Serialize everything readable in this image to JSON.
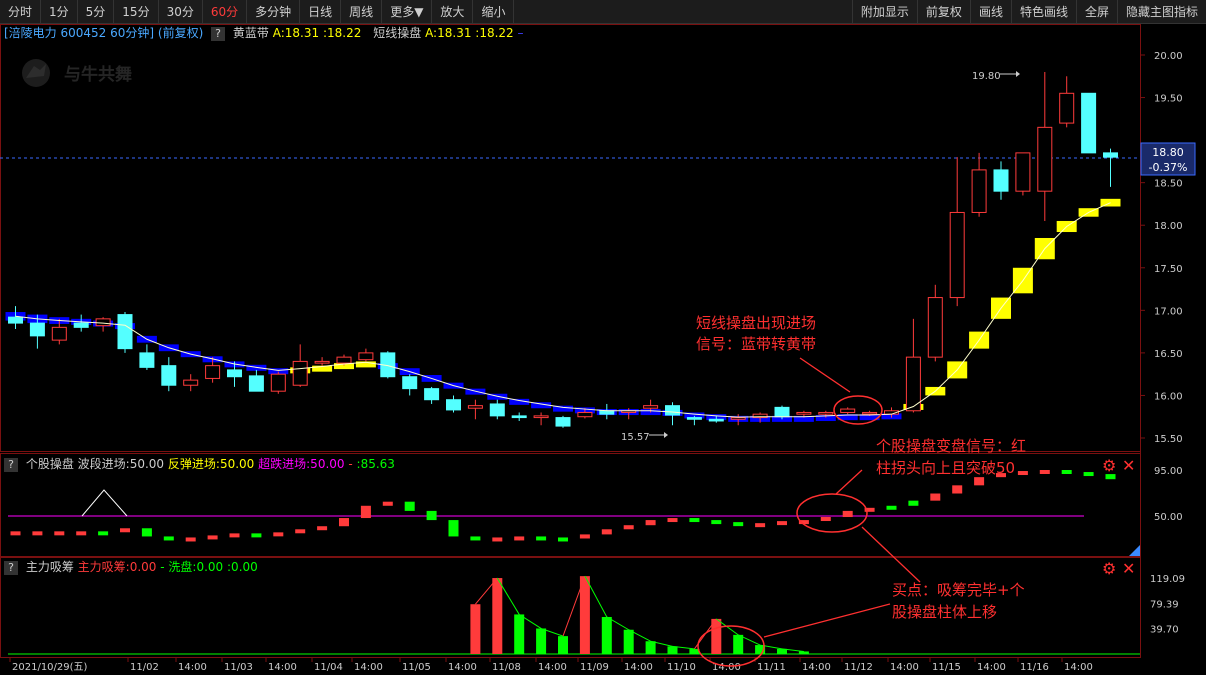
{
  "toolbar": {
    "left": [
      "分时",
      "1分",
      "5分",
      "15分",
      "30分",
      "60分",
      "多分钟",
      "日线",
      "周线",
      "更多▼",
      "放大",
      "缩小"
    ],
    "active": "60分",
    "right": [
      "附加显示",
      "前复权",
      "画线",
      "特色画线",
      "全屏",
      "隐藏主图指标"
    ]
  },
  "main_info": {
    "stock": "[涪陵电力 600452 60分钟] (前复权)",
    "q": "?",
    "ind1_name": "黄蓝带",
    "ind1_vals": "A:18.31",
    "ind1_vals2": ":18.22",
    "ind2_name": "短线操盘",
    "ind2_vals": "A:18.31",
    "ind2_vals2": ":18.22"
  },
  "watermark": "与牛共舞",
  "price_tag": {
    "price": "18.80",
    "change": "-0.37%"
  },
  "high_label": "19.80",
  "low_label": "15.57",
  "sub1_info": {
    "name": "个股操盘",
    "l1": "波段进场:50.00",
    "l2": "反弹进场:50.00",
    "l3": "超跌进场:50.00",
    "l4": "- ",
    "l5": ":85.63"
  },
  "sub2_info": {
    "name": "主力吸筹",
    "l1": "主力吸筹:0.00",
    "l2": "- 洗盘:0.00",
    "l3": ":0.00"
  },
  "annotations": {
    "a1_line1": "短线操盘出现进场",
    "a1_line2": "信号：蓝带转黄带",
    "a2_line1": "个股操盘变盘信号：红",
    "a2_line2": "柱拐头向上且突破50",
    "a3_line1": "买点：吸筹完毕+个",
    "a3_line2": "股操盘柱体上移"
  },
  "controls": {
    "gear": "⚙",
    "close": "✕"
  },
  "price_axis": [
    "20.00",
    "19.50",
    "18.80",
    "18.50",
    "18.00",
    "17.50",
    "17.00",
    "16.50",
    "16.00",
    "15.50"
  ],
  "sub1_axis": [
    "95.00",
    "50.00"
  ],
  "sub2_axis": [
    "119.09",
    "79.39",
    "39.70"
  ],
  "date_axis": [
    "2021/10/29(五)",
    "11/02",
    "14:00",
    "11/03",
    "14:00",
    "11/04",
    "14:00",
    "11/05",
    "14:00",
    "11/08",
    "14:00",
    "11/09",
    "14:00",
    "11/10",
    "14:00",
    "11/11",
    "14:00",
    "11/12",
    "14:00",
    "11/15",
    "14:00",
    "11/16",
    "14:00"
  ],
  "colors": {
    "up": "#ff3b3b",
    "down": "#54ffff",
    "yellow": "#ffff00",
    "blue": "#0000ff",
    "magenta": "#ff00ff",
    "green": "#00ff00"
  },
  "chart_data": {
    "type": "candlestick",
    "ylim": [
      15.4,
      20.1
    ],
    "candles": [
      {
        "o": 16.92,
        "h": 17.05,
        "l": 16.78,
        "c": 16.85
      },
      {
        "o": 16.85,
        "h": 16.95,
        "l": 16.55,
        "c": 16.7
      },
      {
        "o": 16.65,
        "h": 16.9,
        "l": 16.6,
        "c": 16.8
      },
      {
        "o": 16.85,
        "h": 16.95,
        "l": 16.75,
        "c": 16.8
      },
      {
        "o": 16.82,
        "h": 16.92,
        "l": 16.75,
        "c": 16.9
      },
      {
        "o": 16.95,
        "h": 16.98,
        "l": 16.5,
        "c": 16.55
      },
      {
        "o": 16.5,
        "h": 16.6,
        "l": 16.3,
        "c": 16.33
      },
      {
        "o": 16.35,
        "h": 16.45,
        "l": 16.05,
        "c": 16.12
      },
      {
        "o": 16.12,
        "h": 16.25,
        "l": 16.05,
        "c": 16.18
      },
      {
        "o": 16.2,
        "h": 16.45,
        "l": 16.15,
        "c": 16.35
      },
      {
        "o": 16.3,
        "h": 16.4,
        "l": 16.1,
        "c": 16.22
      },
      {
        "o": 16.23,
        "h": 16.3,
        "l": 16.05,
        "c": 16.05
      },
      {
        "o": 16.05,
        "h": 16.28,
        "l": 16.02,
        "c": 16.25
      },
      {
        "o": 16.12,
        "h": 16.6,
        "l": 16.1,
        "c": 16.4
      },
      {
        "o": 16.38,
        "h": 16.45,
        "l": 16.35,
        "c": 16.4
      },
      {
        "o": 16.38,
        "h": 16.48,
        "l": 16.35,
        "c": 16.45
      },
      {
        "o": 16.42,
        "h": 16.55,
        "l": 16.4,
        "c": 16.5
      },
      {
        "o": 16.5,
        "h": 16.52,
        "l": 16.2,
        "c": 16.22
      },
      {
        "o": 16.22,
        "h": 16.25,
        "l": 16.0,
        "c": 16.08
      },
      {
        "o": 16.08,
        "h": 16.1,
        "l": 15.9,
        "c": 15.95
      },
      {
        "o": 15.95,
        "h": 16.0,
        "l": 15.8,
        "c": 15.83
      },
      {
        "o": 15.85,
        "h": 15.95,
        "l": 15.72,
        "c": 15.88
      },
      {
        "o": 15.9,
        "h": 15.95,
        "l": 15.72,
        "c": 15.76
      },
      {
        "o": 15.76,
        "h": 15.8,
        "l": 15.7,
        "c": 15.74
      },
      {
        "o": 15.74,
        "h": 15.8,
        "l": 15.65,
        "c": 15.76
      },
      {
        "o": 15.74,
        "h": 15.76,
        "l": 15.62,
        "c": 15.64
      },
      {
        "o": 15.75,
        "h": 15.85,
        "l": 15.73,
        "c": 15.8
      },
      {
        "o": 15.82,
        "h": 15.9,
        "l": 15.72,
        "c": 15.78
      },
      {
        "o": 15.8,
        "h": 15.85,
        "l": 15.72,
        "c": 15.82
      },
      {
        "o": 15.85,
        "h": 15.95,
        "l": 15.8,
        "c": 15.88
      },
      {
        "o": 15.88,
        "h": 15.92,
        "l": 15.65,
        "c": 15.77
      },
      {
        "o": 15.74,
        "h": 15.76,
        "l": 15.65,
        "c": 15.72
      },
      {
        "o": 15.72,
        "h": 15.76,
        "l": 15.68,
        "c": 15.7
      },
      {
        "o": 15.72,
        "h": 15.78,
        "l": 15.65,
        "c": 15.74
      },
      {
        "o": 15.74,
        "h": 15.8,
        "l": 15.68,
        "c": 15.78
      },
      {
        "o": 15.86,
        "h": 15.88,
        "l": 15.72,
        "c": 15.75
      },
      {
        "o": 15.78,
        "h": 15.82,
        "l": 15.74,
        "c": 15.8
      },
      {
        "o": 15.78,
        "h": 15.82,
        "l": 15.74,
        "c": 15.8
      },
      {
        "o": 15.8,
        "h": 15.86,
        "l": 15.78,
        "c": 15.84
      },
      {
        "o": 15.8,
        "h": 15.82,
        "l": 15.76,
        "c": 15.8
      },
      {
        "o": 15.78,
        "h": 15.86,
        "l": 15.74,
        "c": 15.82
      },
      {
        "o": 15.82,
        "h": 16.9,
        "l": 15.8,
        "c": 16.45
      },
      {
        "o": 16.45,
        "h": 17.3,
        "l": 16.4,
        "c": 17.15
      },
      {
        "o": 17.15,
        "h": 18.8,
        "l": 17.05,
        "c": 18.15
      },
      {
        "o": 18.15,
        "h": 18.85,
        "l": 18.1,
        "c": 18.65
      },
      {
        "o": 18.65,
        "h": 18.75,
        "l": 18.3,
        "c": 18.4
      },
      {
        "o": 18.4,
        "h": 18.85,
        "l": 18.35,
        "c": 18.85
      },
      {
        "o": 18.4,
        "h": 19.8,
        "l": 18.05,
        "c": 19.15
      },
      {
        "o": 19.2,
        "h": 19.75,
        "l": 19.15,
        "c": 19.55
      },
      {
        "o": 19.55,
        "h": 19.55,
        "l": 18.85,
        "c": 18.85
      },
      {
        "o": 18.85,
        "h": 18.9,
        "l": 18.45,
        "c": 18.8
      }
    ],
    "band_a": [
      16.98,
      16.95,
      16.92,
      16.9,
      16.88,
      16.85,
      16.7,
      16.6,
      16.52,
      16.46,
      16.4,
      16.36,
      16.32,
      16.33,
      16.35,
      16.38,
      16.4,
      16.38,
      16.32,
      16.24,
      16.15,
      16.08,
      16.02,
      15.96,
      15.92,
      15.88,
      15.86,
      15.84,
      15.84,
      15.84,
      15.83,
      15.8,
      15.78,
      15.76,
      15.76,
      15.76,
      15.76,
      15.77,
      15.78,
      15.78,
      15.79,
      15.9,
      16.1,
      16.4,
      16.75,
      17.15,
      17.5,
      17.85,
      18.05,
      18.2,
      18.31
    ],
    "band_b": [
      16.88,
      16.85,
      16.84,
      16.83,
      16.82,
      16.8,
      16.62,
      16.52,
      16.45,
      16.4,
      16.34,
      16.3,
      16.27,
      16.3,
      16.33,
      16.36,
      16.38,
      16.32,
      16.24,
      16.16,
      16.08,
      16.02,
      15.96,
      15.92,
      15.88,
      15.84,
      15.82,
      15.8,
      15.8,
      15.8,
      15.78,
      15.76,
      15.74,
      15.73,
      15.74,
      15.74,
      15.74,
      15.75,
      15.76,
      15.76,
      15.77,
      15.84,
      16.0,
      16.2,
      16.55,
      16.9,
      17.2,
      17.6,
      17.92,
      18.1,
      18.22
    ],
    "band_color": [
      "b",
      "b",
      "b",
      "b",
      "b",
      "b",
      "b",
      "b",
      "b",
      "b",
      "b",
      "b",
      "b",
      "y",
      "y",
      "y",
      "y",
      "b",
      "b",
      "b",
      "b",
      "b",
      "b",
      "b",
      "b",
      "b",
      "b",
      "b",
      "b",
      "b",
      "b",
      "b",
      "b",
      "b",
      "b",
      "b",
      "b",
      "b",
      "b",
      "b",
      "b",
      "y",
      "y",
      "y",
      "y",
      "y",
      "y",
      "y",
      "y",
      "y",
      "y"
    ],
    "sub1_ylim": [
      20,
      100
    ],
    "sub1_bars": [
      {
        "v": 35,
        "c": "r"
      },
      {
        "v": 35,
        "c": "r"
      },
      {
        "v": 35,
        "c": "r"
      },
      {
        "v": 35,
        "c": "r"
      },
      {
        "v": 35,
        "c": "g"
      },
      {
        "v": 38,
        "c": "r"
      },
      {
        "v": 30,
        "c": "g"
      },
      {
        "v": 28,
        "c": "g"
      },
      {
        "v": 29,
        "c": "r"
      },
      {
        "v": 31,
        "c": "r"
      },
      {
        "v": 33,
        "c": "r"
      },
      {
        "v": 32,
        "c": "g"
      },
      {
        "v": 34,
        "c": "r"
      },
      {
        "v": 37,
        "c": "r"
      },
      {
        "v": 40,
        "c": "r"
      },
      {
        "v": 48,
        "c": "r"
      },
      {
        "v": 60,
        "c": "r"
      },
      {
        "v": 64,
        "c": "r"
      },
      {
        "v": 55,
        "c": "g"
      },
      {
        "v": 46,
        "c": "g"
      },
      {
        "v": 30,
        "c": "g"
      },
      {
        "v": 28,
        "c": "g"
      },
      {
        "v": 29,
        "c": "r"
      },
      {
        "v": 30,
        "c": "r"
      },
      {
        "v": 29,
        "c": "g"
      },
      {
        "v": 28,
        "c": "g"
      },
      {
        "v": 32,
        "c": "r"
      },
      {
        "v": 37,
        "c": "r"
      },
      {
        "v": 41,
        "c": "r"
      },
      {
        "v": 46,
        "c": "r"
      },
      {
        "v": 48,
        "c": "r"
      },
      {
        "v": 46,
        "c": "g"
      },
      {
        "v": 44,
        "c": "g"
      },
      {
        "v": 42,
        "c": "g"
      },
      {
        "v": 43,
        "c": "r"
      },
      {
        "v": 45,
        "c": "r"
      },
      {
        "v": 46,
        "c": "r"
      },
      {
        "v": 49,
        "c": "r"
      },
      {
        "v": 55,
        "c": "r"
      },
      {
        "v": 58,
        "c": "r"
      },
      {
        "v": 60,
        "c": "g"
      },
      {
        "v": 65,
        "c": "g"
      },
      {
        "v": 72,
        "c": "r"
      },
      {
        "v": 80,
        "c": "r"
      },
      {
        "v": 88,
        "c": "r"
      },
      {
        "v": 92,
        "c": "r"
      },
      {
        "v": 94,
        "c": "r"
      },
      {
        "v": 95,
        "c": "r"
      },
      {
        "v": 93,
        "c": "g"
      },
      {
        "v": 91,
        "c": "g"
      },
      {
        "v": 86,
        "c": "g"
      }
    ],
    "sub1_line": 50,
    "sub2_ylim": [
      0,
      130
    ],
    "sub2_bars": [
      {
        "v": 0,
        "c": "g"
      },
      {
        "v": 0,
        "c": "g"
      },
      {
        "v": 0,
        "c": "g"
      },
      {
        "v": 0,
        "c": "g"
      },
      {
        "v": 0,
        "c": "g"
      },
      {
        "v": 0,
        "c": "g"
      },
      {
        "v": 0,
        "c": "g"
      },
      {
        "v": 0,
        "c": "g"
      },
      {
        "v": 0,
        "c": "g"
      },
      {
        "v": 0,
        "c": "g"
      },
      {
        "v": 0,
        "c": "g"
      },
      {
        "v": 0,
        "c": "g"
      },
      {
        "v": 0,
        "c": "g"
      },
      {
        "v": 0,
        "c": "g"
      },
      {
        "v": 0,
        "c": "g"
      },
      {
        "v": 0,
        "c": "g"
      },
      {
        "v": 0,
        "c": "g"
      },
      {
        "v": 0,
        "c": "g"
      },
      {
        "v": 0,
        "c": "g"
      },
      {
        "v": 0,
        "c": "g"
      },
      {
        "v": 0,
        "c": "g"
      },
      {
        "v": 78,
        "c": "r"
      },
      {
        "v": 119,
        "c": "r"
      },
      {
        "v": 62,
        "c": "g"
      },
      {
        "v": 40,
        "c": "g"
      },
      {
        "v": 28,
        "c": "g"
      },
      {
        "v": 122,
        "c": "r"
      },
      {
        "v": 58,
        "c": "g"
      },
      {
        "v": 38,
        "c": "g"
      },
      {
        "v": 20,
        "c": "g"
      },
      {
        "v": 12,
        "c": "g"
      },
      {
        "v": 8,
        "c": "g"
      },
      {
        "v": 55,
        "c": "r"
      },
      {
        "v": 30,
        "c": "g"
      },
      {
        "v": 14,
        "c": "g"
      },
      {
        "v": 8,
        "c": "g"
      },
      {
        "v": 4,
        "c": "g"
      },
      {
        "v": 0,
        "c": "g"
      },
      {
        "v": 0,
        "c": "g"
      },
      {
        "v": 0,
        "c": "g"
      },
      {
        "v": 0,
        "c": "g"
      },
      {
        "v": 0,
        "c": "g"
      },
      {
        "v": 0,
        "c": "g"
      },
      {
        "v": 0,
        "c": "g"
      },
      {
        "v": 0,
        "c": "g"
      },
      {
        "v": 0,
        "c": "g"
      },
      {
        "v": 0,
        "c": "g"
      },
      {
        "v": 0,
        "c": "g"
      },
      {
        "v": 0,
        "c": "g"
      },
      {
        "v": 0,
        "c": "g"
      },
      {
        "v": 0,
        "c": "g"
      }
    ]
  }
}
